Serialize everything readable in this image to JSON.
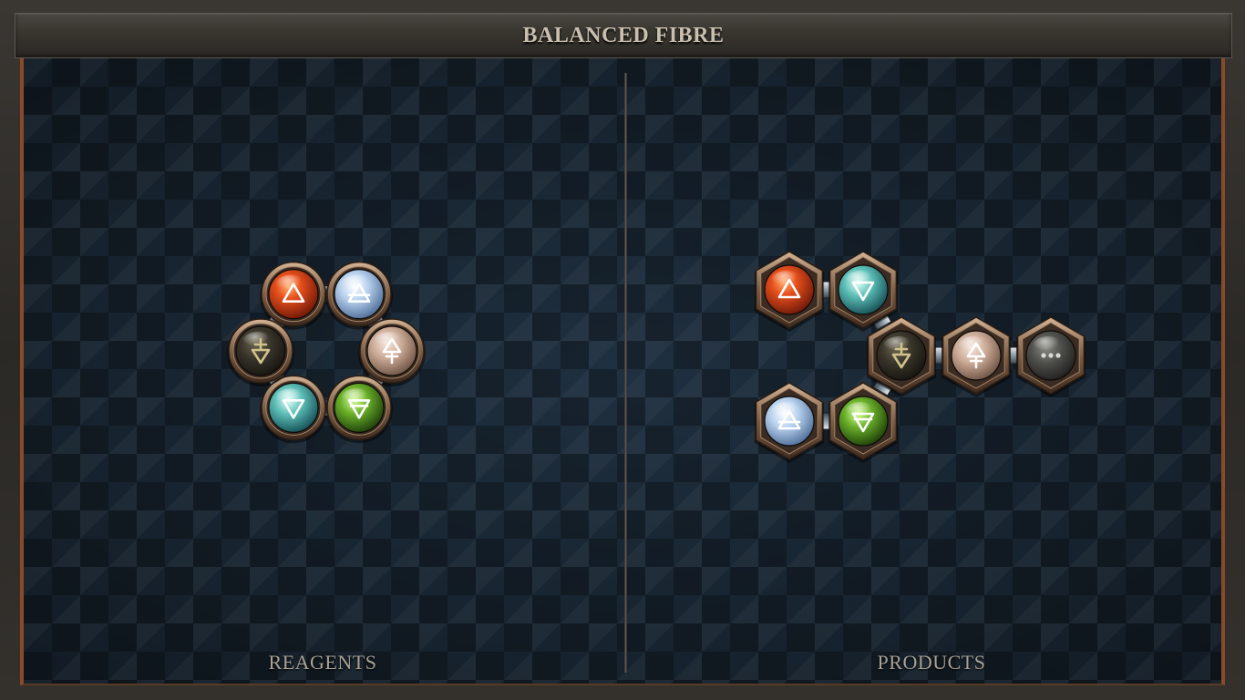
{
  "title": "BALANCED FIBRE",
  "panels": {
    "reagents_label": "REAGENTS",
    "products_label": "PRODUCTS"
  },
  "colors": {
    "fire": "#d4401a",
    "air": "#a9c4e6",
    "water": "#4fb3b0",
    "earth": "#6aa82a",
    "salt": "#c9ab95",
    "lead": "#3b372c",
    "blank": "#5a5a55"
  },
  "elements": {
    "fire": {
      "icon": "fire-symbol-icon"
    },
    "air": {
      "icon": "air-symbol-icon"
    },
    "water": {
      "icon": "water-symbol-icon"
    },
    "earth": {
      "icon": "earth-symbol-icon"
    },
    "salt": {
      "icon": "salt-symbol-icon"
    },
    "lead": {
      "icon": "lead-symbol-icon"
    },
    "blank": {
      "icon": "ellipsis-icon"
    }
  }
}
